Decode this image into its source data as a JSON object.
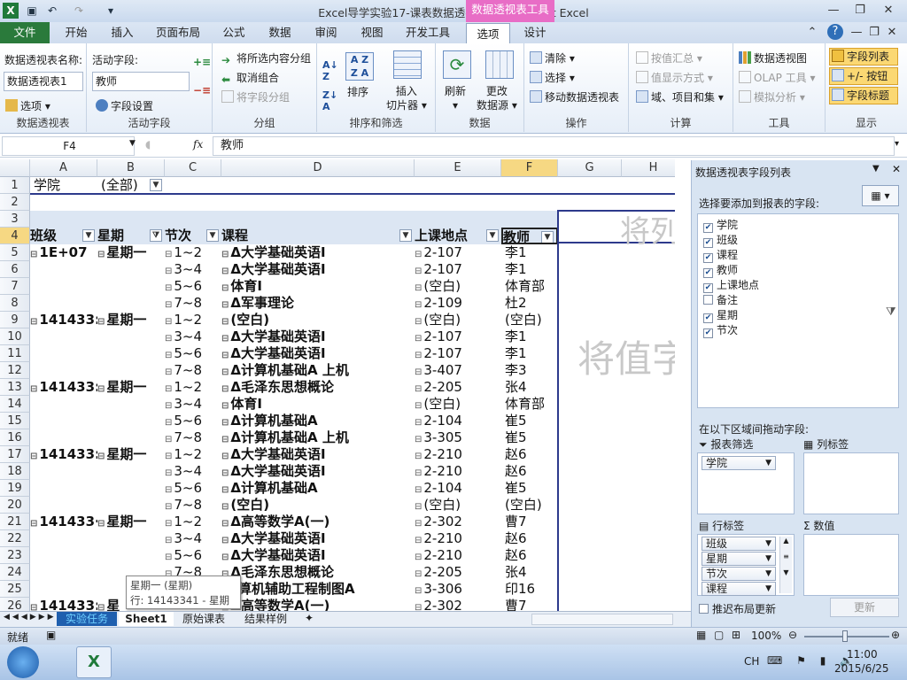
{
  "window": {
    "title": "Excel导学实验17-课表数据透视表1 - Microsoft Excel",
    "contextual_title": "数据透视表工具"
  },
  "tabs": [
    "文件",
    "开始",
    "插入",
    "页面布局",
    "公式",
    "数据",
    "审阅",
    "视图",
    "开发工具",
    "选项",
    "设计"
  ],
  "ribbon": {
    "pivot_name_label": "数据透视表名称:",
    "pivot_name_value": "数据透视表1",
    "options_btn": "选项",
    "group_pivot": "数据透视表",
    "active_field_label": "活动字段:",
    "active_field_value": "教师",
    "field_settings_btn": "字段设置",
    "group_active_field": "活动字段",
    "group_selection": "将所选内容分组",
    "ungroup": "取消组合",
    "group_field": "将字段分组",
    "group_group": "分组",
    "sort_btn": "排序",
    "insert_slicer": "插入\n切片器",
    "insert_slicer_l1": "插入",
    "insert_slicer_l2": "切片器",
    "group_sort": "排序和筛选",
    "refresh": "刷新",
    "change_source_l1": "更改",
    "change_source_l2": "数据源",
    "group_data": "数据",
    "clear": "清除",
    "select": "选择",
    "move_pivot": "移动数据透视表",
    "group_actions": "操作",
    "summarize_by": "按值汇总",
    "show_values_as": "值显示方式",
    "fields_items_sets": "域、项目和集",
    "group_calc": "计算",
    "pivot_chart": "数据透视图",
    "olap_tools": "OLAP 工具",
    "what_if": "模拟分析",
    "group_tools": "工具",
    "field_list": "字段列表",
    "plus_minus": "+/- 按钮",
    "field_headers": "字段标题",
    "group_show": "显示"
  },
  "formula_bar": {
    "name_box": "F4",
    "fx": "fx",
    "content": "教师"
  },
  "columns": [
    "A",
    "B",
    "C",
    "D",
    "E",
    "F",
    "G",
    "H"
  ],
  "rows": [
    {
      "n": "1",
      "a": "学院",
      "b": "(全部)",
      "c": "",
      "d": "",
      "e": "",
      "f": ""
    },
    {
      "n": "2",
      "a": "",
      "b": "",
      "c": "",
      "d": "",
      "e": "",
      "f": ""
    },
    {
      "n": "3",
      "a": "",
      "b": "",
      "c": "",
      "d": "",
      "e": "",
      "f": ""
    },
    {
      "n": "4",
      "a": "班级",
      "b": "星期",
      "c": "节次",
      "d": "课程",
      "e": "上课地点",
      "f": "教师"
    },
    {
      "n": "5",
      "a": "1E+07",
      "b": "星期一",
      "c": "1~2",
      "d": "Δ大学基础英语Ⅰ",
      "e": "2-107",
      "f": "李1"
    },
    {
      "n": "6",
      "a": "",
      "b": "",
      "c": "3~4",
      "d": "Δ大学基础英语Ⅰ",
      "e": "2-107",
      "f": "李1"
    },
    {
      "n": "7",
      "a": "",
      "b": "",
      "c": "5~6",
      "d": "体育Ⅰ",
      "e": "(空白)",
      "f": "体育部"
    },
    {
      "n": "8",
      "a": "",
      "b": "",
      "c": "7~8",
      "d": "Δ军事理论",
      "e": "2-109",
      "f": "杜2"
    },
    {
      "n": "9",
      "a": "141433:",
      "b": "星期一",
      "c": "1~2",
      "d": "(空白)",
      "e": "(空白)",
      "f": "(空白)"
    },
    {
      "n": "10",
      "a": "",
      "b": "",
      "c": "3~4",
      "d": "Δ大学基础英语Ⅰ",
      "e": "2-107",
      "f": "李1"
    },
    {
      "n": "11",
      "a": "",
      "b": "",
      "c": "5~6",
      "d": "Δ大学基础英语Ⅰ",
      "e": "2-107",
      "f": "李1"
    },
    {
      "n": "12",
      "a": "",
      "b": "",
      "c": "7~8",
      "d": "Δ计算机基础A 上机",
      "e": "3-407",
      "f": "李3"
    },
    {
      "n": "13",
      "a": "141433:",
      "b": "星期一",
      "c": "1~2",
      "d": "Δ毛泽东思想概论",
      "e": "2-205",
      "f": "张4"
    },
    {
      "n": "14",
      "a": "",
      "b": "",
      "c": "3~4",
      "d": "体育Ⅰ",
      "e": "(空白)",
      "f": "体育部"
    },
    {
      "n": "15",
      "a": "",
      "b": "",
      "c": "5~6",
      "d": "Δ计算机基础A",
      "e": "2-104",
      "f": "崔5"
    },
    {
      "n": "16",
      "a": "",
      "b": "",
      "c": "7~8",
      "d": "Δ计算机基础A 上机",
      "e": "3-305",
      "f": "崔5"
    },
    {
      "n": "17",
      "a": "141433:",
      "b": "星期一",
      "c": "1~2",
      "d": "Δ大学基础英语Ⅰ",
      "e": "2-210",
      "f": "赵6"
    },
    {
      "n": "18",
      "a": "",
      "b": "",
      "c": "3~4",
      "d": "Δ大学基础英语Ⅰ",
      "e": "2-210",
      "f": "赵6"
    },
    {
      "n": "19",
      "a": "",
      "b": "",
      "c": "5~6",
      "d": "Δ计算机基础A",
      "e": "2-104",
      "f": "崔5"
    },
    {
      "n": "20",
      "a": "",
      "b": "",
      "c": "7~8",
      "d": "(空白)",
      "e": "(空白)",
      "f": "(空白)"
    },
    {
      "n": "21",
      "a": "141433·",
      "b": "星期一",
      "c": "1~2",
      "d": "Δ高等数学A(一)",
      "e": "2-302",
      "f": "曹7"
    },
    {
      "n": "22",
      "a": "",
      "b": "",
      "c": "3~4",
      "d": "Δ大学基础英语Ⅰ",
      "e": "2-210",
      "f": "赵6"
    },
    {
      "n": "23",
      "a": "",
      "b": "",
      "c": "5~6",
      "d": "Δ大学基础英语Ⅰ",
      "e": "2-210",
      "f": "赵6"
    },
    {
      "n": "24",
      "a": "",
      "b": "",
      "c": "7~8",
      "d": "Δ毛泽东思想概论",
      "e": "2-205",
      "f": "张4"
    },
    {
      "n": "25",
      "a": "",
      "b": "",
      "c": "",
      "d": "计算机辅助工程制图A",
      "e": "3-306",
      "f": "印16"
    },
    {
      "n": "26",
      "a": "141433:",
      "b": "星",
      "c": "",
      "d": "Δ高等数学A(一)",
      "e": "2-302",
      "f": "曹7"
    }
  ],
  "drop_hints": {
    "col": "将列",
    "val": "将值字"
  },
  "tooltip": {
    "line1": "星期一 (星期)",
    "line2": "行: 14143341 - 星期一"
  },
  "field_pane": {
    "title": "数据透视表字段列表",
    "choose_label": "选择要添加到报表的字段:",
    "fields": [
      {
        "name": "学院",
        "checked": true
      },
      {
        "name": "班级",
        "checked": true
      },
      {
        "name": "课程",
        "checked": true
      },
      {
        "name": "教师",
        "checked": true
      },
      {
        "name": "上课地点",
        "checked": true
      },
      {
        "name": "备注",
        "checked": false
      },
      {
        "name": "星期",
        "checked": true
      },
      {
        "name": "节次",
        "checked": true
      }
    ],
    "drag_label": "在以下区域间拖动字段:",
    "report_filter": "报表筛选",
    "column_labels": "列标签",
    "row_labels": "行标签",
    "values": "数值",
    "filter_items": [
      "学院"
    ],
    "row_items": [
      "班级",
      "星期",
      "节次",
      "课程"
    ],
    "defer_label": "推迟布局更新",
    "update_btn": "更新"
  },
  "sheet_tabs": [
    "实验任务",
    "Sheet1",
    "原始课表",
    "结果样例"
  ],
  "status": {
    "ready": "就绪",
    "zoom": "100%"
  },
  "taskbar": {
    "lang": "CH",
    "time": "11:00",
    "date": "2015/6/25"
  },
  "colors": {
    "file_tab": "#2a7a3b",
    "contextual": "#e86dc6",
    "highlight": "#f6d883"
  }
}
